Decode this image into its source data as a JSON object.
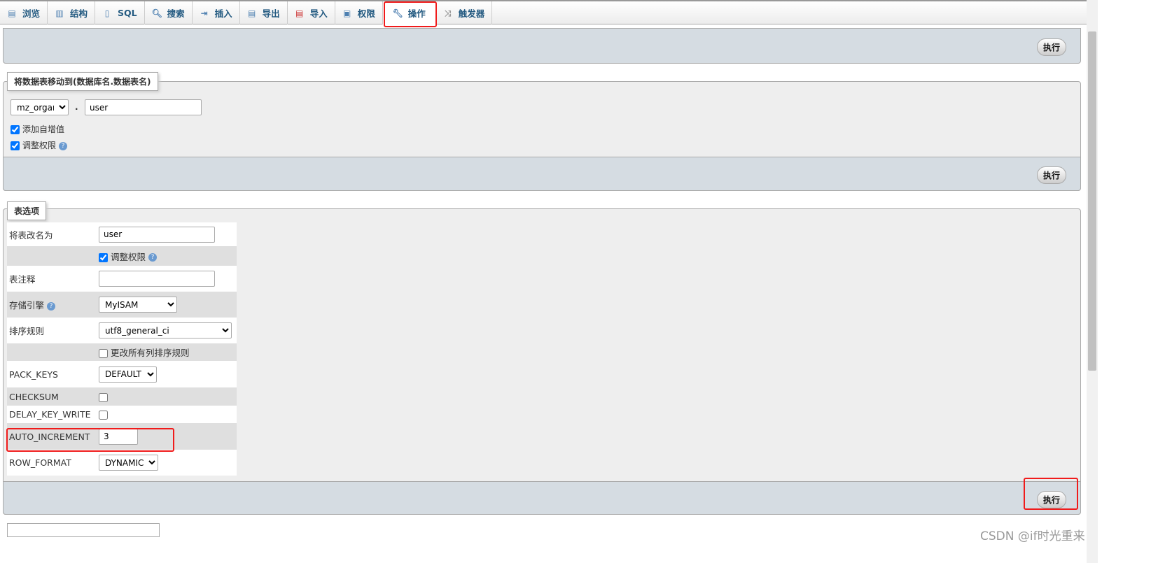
{
  "tabs": [
    {
      "label": "浏览",
      "icon": "browse-icon"
    },
    {
      "label": "结构",
      "icon": "structure-icon"
    },
    {
      "label": "SQL",
      "icon": "sql-icon"
    },
    {
      "label": "搜索",
      "icon": "search-icon"
    },
    {
      "label": "插入",
      "icon": "insert-icon"
    },
    {
      "label": "导出",
      "icon": "export-icon"
    },
    {
      "label": "导入",
      "icon": "import-icon"
    },
    {
      "label": "权限",
      "icon": "privileges-icon"
    },
    {
      "label": "操作",
      "icon": "wrench-icon",
      "active": true
    },
    {
      "label": "触发器",
      "icon": "triggers-icon"
    }
  ],
  "go_label": "执行",
  "move": {
    "legend": "将数据表移动到(数据库名.数据表名)",
    "db": "mz_organ",
    "dot": ".",
    "table": "user",
    "auto_inc_label": "添加自增值",
    "adjust_priv_label": "调整权限"
  },
  "options": {
    "legend": "表选项",
    "rename_label": "将表改名为",
    "rename_value": "user",
    "adjust_priv_label": "调整权限",
    "comment_label": "表注释",
    "comment_value": "",
    "engine_label": "存储引擎",
    "engine_value": "MyISAM",
    "collation_label": "排序规则",
    "collation_value": "utf8_general_ci",
    "change_all_label": "更改所有列排序规则",
    "pack_keys_label": "PACK_KEYS",
    "pack_keys_value": "DEFAULT",
    "checksum_label": "CHECKSUM",
    "delay_key_write_label": "DELAY_KEY_WRITE",
    "auto_increment_label": "AUTO_INCREMENT",
    "auto_increment_value": "3",
    "row_format_label": "ROW_FORMAT",
    "row_format_value": "DYNAMIC"
  },
  "watermark": "CSDN @if时光重来",
  "colors": {
    "highlight": "#f01b1b",
    "footer": "#d5dce2",
    "tab_text": "#235a81"
  }
}
